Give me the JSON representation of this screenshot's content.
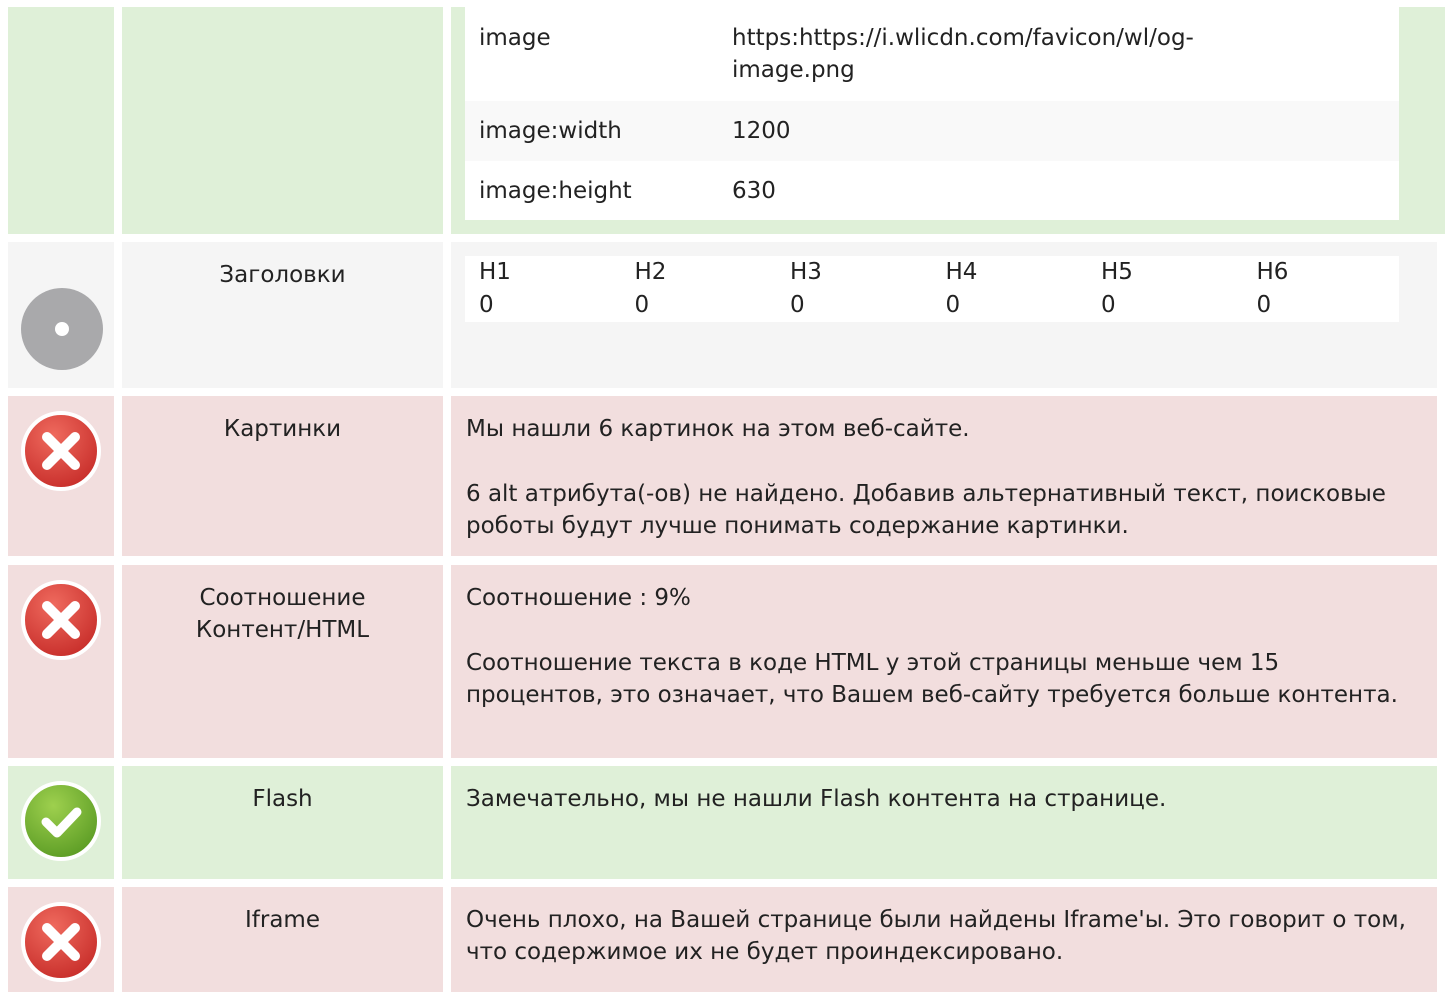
{
  "og_table": {
    "rows": [
      {
        "key": "image",
        "value": "https:https://i.wlicdn.com/favicon/wl/og-image.png"
      },
      {
        "key": "image:width",
        "value": "1200"
      },
      {
        "key": "image:height",
        "value": "630"
      }
    ]
  },
  "headings": {
    "label": "Заголовки",
    "columns": [
      {
        "tag": "H1",
        "count": "0"
      },
      {
        "tag": "H2",
        "count": "0"
      },
      {
        "tag": "H3",
        "count": "0"
      },
      {
        "tag": "H4",
        "count": "0"
      },
      {
        "tag": "H5",
        "count": "0"
      },
      {
        "tag": "H6",
        "count": "0"
      }
    ],
    "status_icon": "neutral-dot-icon"
  },
  "images": {
    "label": "Картинки",
    "status_icon": "error-x-icon",
    "line1": "Мы нашли 6 картинок на этом веб-сайте.",
    "line2": "6 alt атрибута(-ов) не найдено. Добавив альтернативный текст, поисковые роботы будут лучше понимать содержание картинки."
  },
  "ratio": {
    "label": "Соотношение Контент/HTML",
    "status_icon": "error-x-icon",
    "line1": "Соотношение : 9%",
    "line2": "Соотношение текста в коде HTML у этой страницы меньше чем 15 процентов, это означает, что Вашем веб-сайту требуется больше контента."
  },
  "flash": {
    "label": "Flash",
    "status_icon": "success-check-icon",
    "line1": "Замечательно, мы не нашли Flash контента на странице."
  },
  "iframe": {
    "label": "Iframe",
    "status_icon": "error-x-icon",
    "line1": "Очень плохо, на Вашей странице были найдены Iframe'ы. Это говорит о том, что содержимое их не будет проиндексировано."
  },
  "colors": {
    "green_bg": "#dff0d8",
    "red_bg": "#f2dede",
    "grey_bg": "#f5f5f5",
    "error_red": "#d9534f",
    "success_green": "#6db33f",
    "neutral_grey": "#a8a8a8"
  }
}
